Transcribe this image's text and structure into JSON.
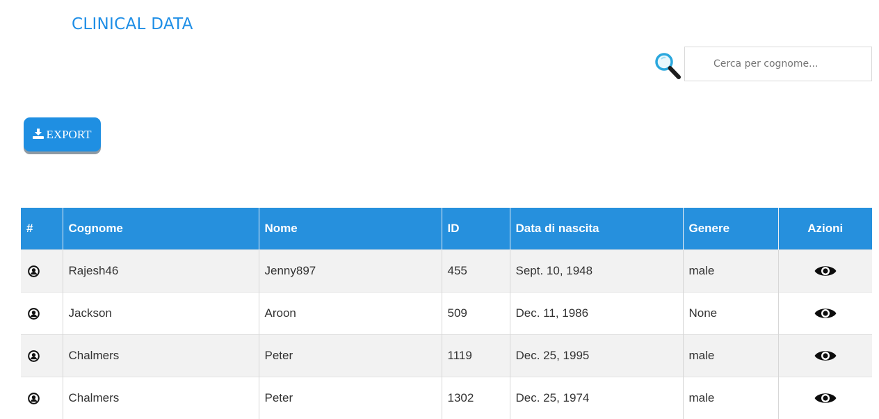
{
  "brand": {
    "title": "CLINICAL DATA",
    "icon": "medical-cross-logo",
    "color": "#1e8ee6"
  },
  "search": {
    "placeholder": "Cerca per cognome...",
    "value": "",
    "icon": "search-icon"
  },
  "export": {
    "label": "EXPORT",
    "icon": "download-icon",
    "color": "#1f8fe2"
  },
  "table": {
    "columns": [
      "#",
      "Cognome",
      "Nome",
      "ID",
      "Data di nascita",
      "Genere",
      "Azioni"
    ],
    "header_color": "#2690dd",
    "rows": [
      {
        "cognome": "Rajesh46",
        "nome": "Jenny897",
        "id": "455",
        "nascita": "Sept. 10, 1948",
        "genere": "male"
      },
      {
        "cognome": "Jackson",
        "nome": "Aroon",
        "id": "509",
        "nascita": "Dec. 11, 1986",
        "genere": "None"
      },
      {
        "cognome": "Chalmers",
        "nome": "Peter",
        "id": "1119",
        "nascita": "Dec. 25, 1995",
        "genere": "male"
      },
      {
        "cognome": "Chalmers",
        "nome": "Peter",
        "id": "1302",
        "nascita": "Dec. 25, 1974",
        "genere": "male"
      }
    ]
  }
}
